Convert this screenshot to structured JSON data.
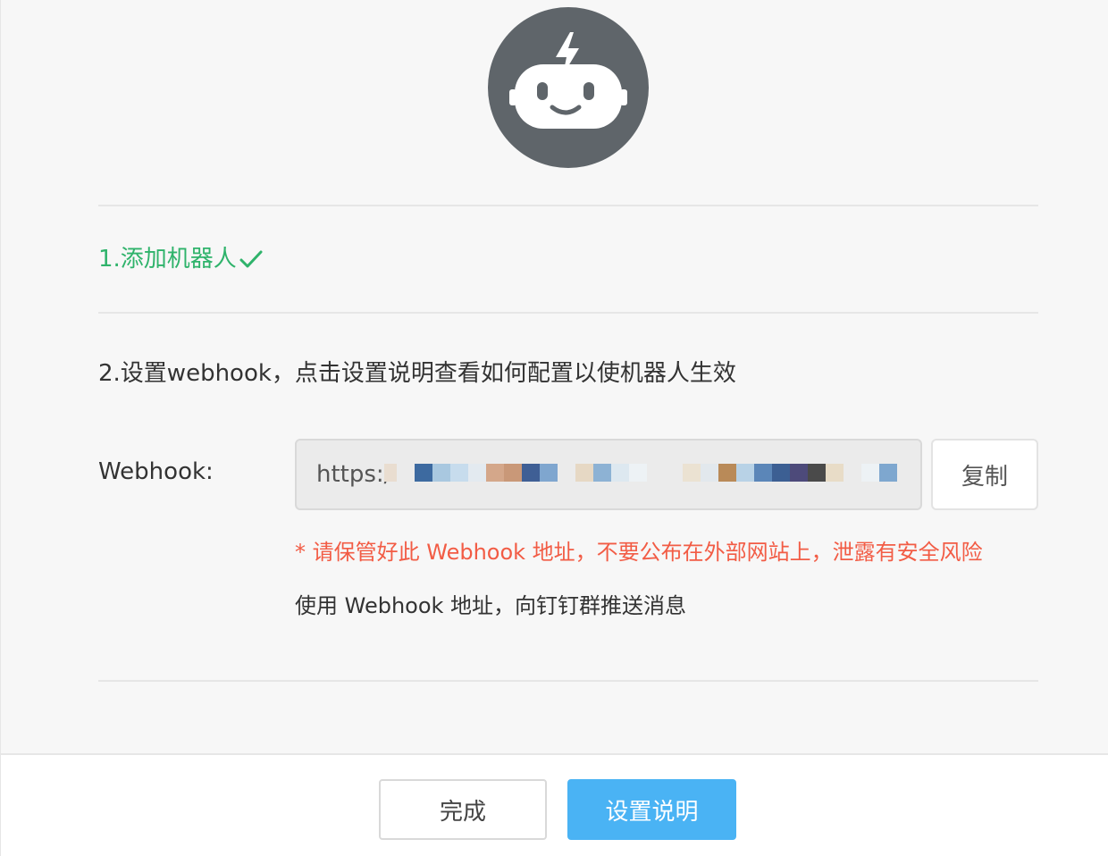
{
  "step1": {
    "text": "1.添加机器人"
  },
  "step2": {
    "text": "2.设置webhook，点击设置说明查看如何配置以使机器人生效"
  },
  "webhook": {
    "label": "Webhook:",
    "value_visible_prefix": "https:/",
    "copy_label": "复制",
    "warning": "* 请保管好此 Webhook 地址，不要公布在外部网站上，泄露有安全风险",
    "usage": "使用 Webhook 地址，向钉钉群推送消息"
  },
  "footer": {
    "done_label": "完成",
    "help_label": "设置说明"
  },
  "colors": {
    "success": "#2fb36b",
    "warning": "#f25c45",
    "primary": "#4ab3f4",
    "avatar": "#5f656a"
  },
  "icons": {
    "avatar": "robot-icon",
    "step1_done": "check-icon"
  }
}
